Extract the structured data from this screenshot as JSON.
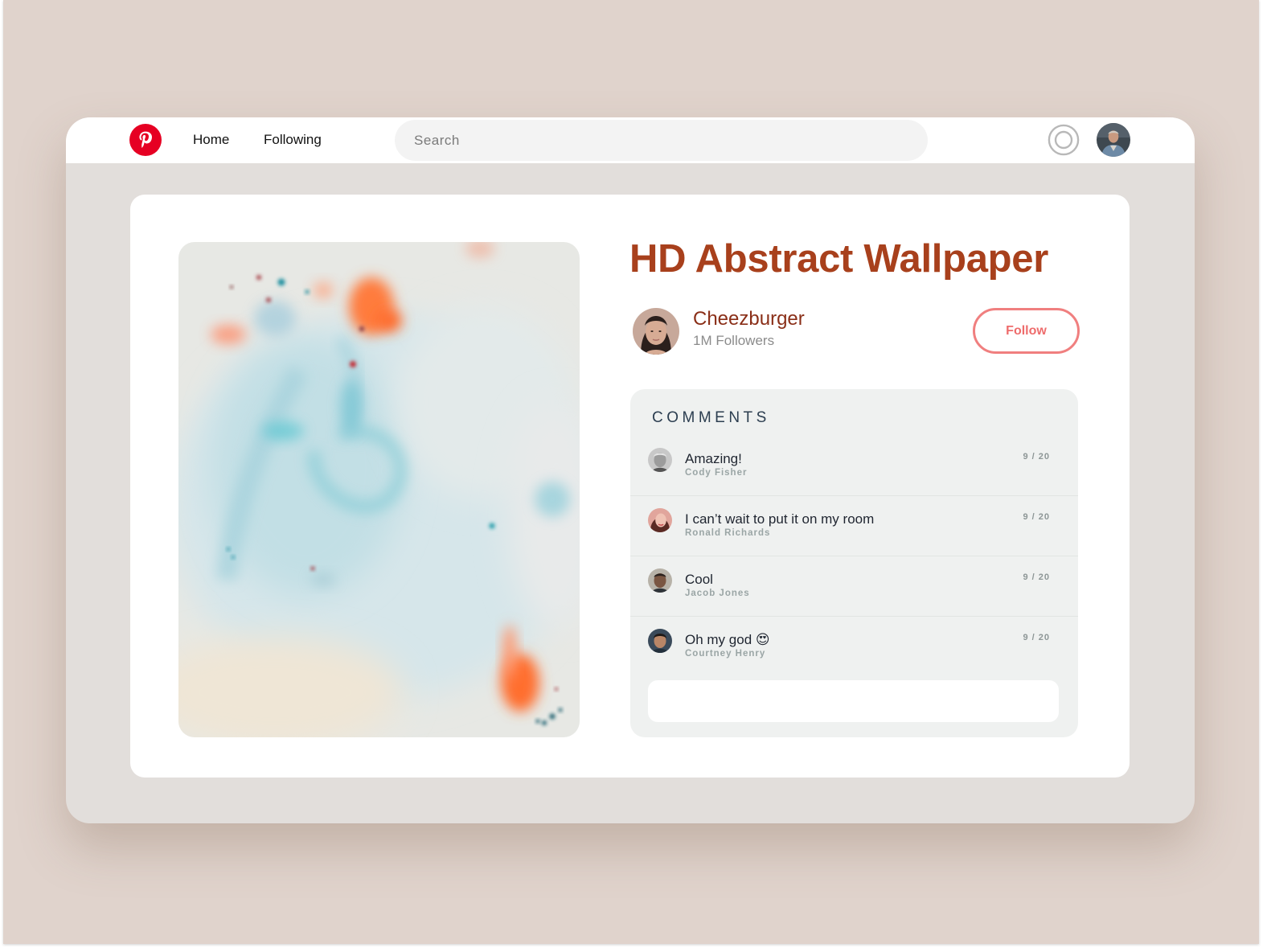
{
  "nav": {
    "logo_icon": "pinterest-logo-icon",
    "home_label": "Home",
    "following_label": "Following",
    "search_placeholder": "Search",
    "notifications_icon": "notifications-ring-icon",
    "avatar_icon": "user-avatar"
  },
  "pin": {
    "image_icon": "abstract-marbled-wallpaper-image",
    "title": "HD Abstract Wallpaper",
    "author": {
      "name": "Cheezburger",
      "followers": "1M Followers"
    },
    "follow_label": "Follow"
  },
  "comments": {
    "heading": "COMMENTS",
    "items": [
      {
        "text": "Amazing!",
        "author": "Cody Fisher",
        "date": "9 / 20"
      },
      {
        "text": "I can’t wait to put it on my room",
        "author": "Ronald Richards",
        "date": "9 / 20"
      },
      {
        "text": "Cool",
        "author": "Jacob Jones",
        "date": "9 / 20"
      },
      {
        "text": "Oh my god 😍",
        "author": "Courtney Henry",
        "date": "9 / 20"
      }
    ],
    "input_value": "",
    "input_placeholder": ""
  },
  "colors": {
    "brand_red": "#e60023",
    "title": "#a8401c",
    "follow_accent": "#ee6c6c",
    "backdrop": "#e0d3cc",
    "window": "#e2dedb"
  }
}
